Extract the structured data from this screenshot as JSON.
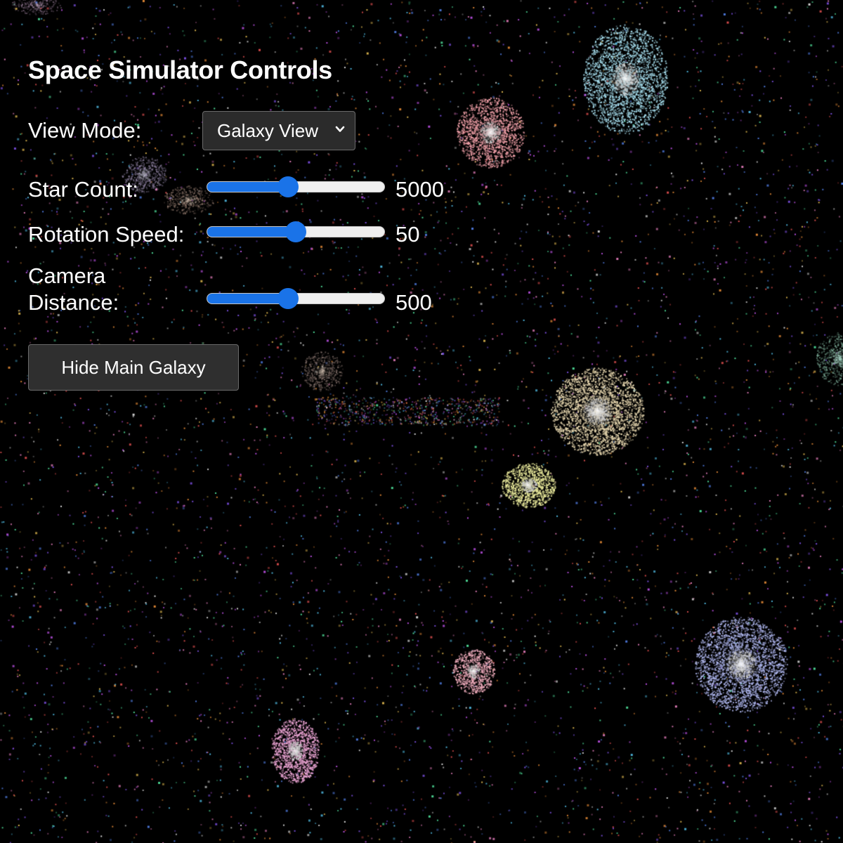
{
  "panel": {
    "title": "Space Simulator Controls",
    "view_mode": {
      "label": "View Mode:",
      "selected": "Galaxy View",
      "icon": "chevron-down-icon"
    },
    "sliders": [
      {
        "label": "Star Count:",
        "value": "5000",
        "level": 0.45
      },
      {
        "label": "Rotation Speed:",
        "value": "50",
        "level": 0.5
      },
      {
        "label_line1": "Camera",
        "label_line2": "Distance:",
        "value": "500",
        "level": 0.45
      }
    ],
    "hide_button": {
      "label": "Hide Main Galaxy"
    }
  },
  "colors": {
    "background": "#000000",
    "accent": "#1a73e8",
    "control_bg": "#2b2b2b",
    "control_border": "#6a6a6a"
  }
}
